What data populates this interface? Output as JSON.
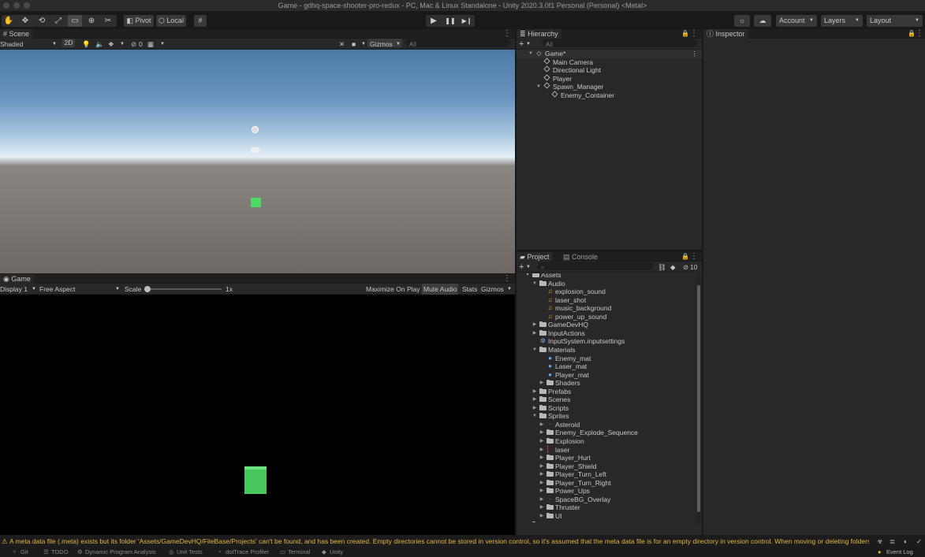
{
  "window": {
    "title": "Game - gdhq-space-shooter-pro-redux - PC, Mac & Linux Standalone - Unity 2020.3.0f1 Personal (Personal) <Metal>"
  },
  "toolbar": {
    "pivot_label": "Pivot",
    "local_label": "Local",
    "account_label": "Account",
    "layers_label": "Layers",
    "layout_label": "Layout"
  },
  "scene": {
    "tab_label": "Scene",
    "shading_mode": "Shaded",
    "mode_2d": "2D",
    "hidden_count": "0",
    "gizmos_label": "Gizmos",
    "search_placeholder": "All"
  },
  "game": {
    "tab_label": "Game",
    "display": "Display 1",
    "aspect": "Free Aspect",
    "scale_label": "Scale",
    "scale_value": "1x",
    "scale_level": 0,
    "maximize_label": "Maximize On Play",
    "mute_label": "Mute Audio",
    "stats_label": "Stats",
    "gizmos_label": "Gizmos"
  },
  "hierarchy": {
    "tab_label": "Hierarchy",
    "search_placeholder": "All",
    "items": [
      {
        "label": "Game*",
        "depth": 0,
        "expanded": true,
        "kind": "scene"
      },
      {
        "label": "Main Camera",
        "depth": 1,
        "kind": "object"
      },
      {
        "label": "Directional Light",
        "depth": 1,
        "kind": "object"
      },
      {
        "label": "Player",
        "depth": 1,
        "kind": "object"
      },
      {
        "label": "Spawn_Manager",
        "depth": 1,
        "expanded": true,
        "kind": "object"
      },
      {
        "label": "Enemy_Container",
        "depth": 2,
        "kind": "object"
      }
    ]
  },
  "inspector": {
    "tab_label": "Inspector"
  },
  "project": {
    "tab_label": "Project",
    "console_label": "Console",
    "hidden_count": "10",
    "items": [
      {
        "label": "Assets",
        "depth": 0,
        "kind": "folder",
        "expanded": true
      },
      {
        "label": "Audio",
        "depth": 1,
        "kind": "folder",
        "expanded": true
      },
      {
        "label": "explosion_sound",
        "depth": 2,
        "kind": "audio"
      },
      {
        "label": "laser_shot",
        "depth": 2,
        "kind": "audio"
      },
      {
        "label": "music_background",
        "depth": 2,
        "kind": "audio"
      },
      {
        "label": "power_up_sound",
        "depth": 2,
        "kind": "audio"
      },
      {
        "label": "GameDevHQ",
        "depth": 1,
        "kind": "folder",
        "collapsed": true
      },
      {
        "label": "InputActions",
        "depth": 1,
        "kind": "folder",
        "collapsed": true
      },
      {
        "label": "InputSystem.inputsettings",
        "depth": 1,
        "kind": "settings"
      },
      {
        "label": "Materials",
        "depth": 1,
        "kind": "folder",
        "expanded": true
      },
      {
        "label": "Enemy_mat",
        "depth": 2,
        "kind": "material"
      },
      {
        "label": "Laser_mat",
        "depth": 2,
        "kind": "material"
      },
      {
        "label": "Player_mat",
        "depth": 2,
        "kind": "material"
      },
      {
        "label": "Shaders",
        "depth": 2,
        "kind": "folder",
        "collapsed": true
      },
      {
        "label": "Prefabs",
        "depth": 1,
        "kind": "folder",
        "collapsed": true
      },
      {
        "label": "Scenes",
        "depth": 1,
        "kind": "folder",
        "collapsed": true
      },
      {
        "label": "Scripts",
        "depth": 1,
        "kind": "folder",
        "collapsed": true
      },
      {
        "label": "Sprites",
        "depth": 1,
        "kind": "folder",
        "expanded": true
      },
      {
        "label": "Asteroid",
        "depth": 2,
        "kind": "sprite",
        "collapsed": true
      },
      {
        "label": "Enemy_Explode_Sequence",
        "depth": 2,
        "kind": "folder",
        "collapsed": true
      },
      {
        "label": "Explosion",
        "depth": 2,
        "kind": "folder",
        "collapsed": true
      },
      {
        "label": "laser",
        "depth": 2,
        "kind": "sprite-red",
        "collapsed": true
      },
      {
        "label": "Player_Hurt",
        "depth": 2,
        "kind": "folder",
        "collapsed": true
      },
      {
        "label": "Player_Shield",
        "depth": 2,
        "kind": "folder",
        "collapsed": true
      },
      {
        "label": "Player_Turn_Left",
        "depth": 2,
        "kind": "folder",
        "collapsed": true
      },
      {
        "label": "Player_Turn_Right",
        "depth": 2,
        "kind": "folder",
        "collapsed": true
      },
      {
        "label": "Power_Ups",
        "depth": 2,
        "kind": "folder",
        "collapsed": true
      },
      {
        "label": "SpaceBG_Overlay",
        "depth": 2,
        "kind": "sprite",
        "collapsed": true
      },
      {
        "label": "Thruster",
        "depth": 2,
        "kind": "folder",
        "collapsed": true
      },
      {
        "label": "UI",
        "depth": 2,
        "kind": "folder",
        "collapsed": true
      },
      {
        "label": "Packages",
        "depth": 0,
        "kind": "folder",
        "collapsed": true
      }
    ]
  },
  "status": {
    "message": "A meta data file (.meta) exists but its folder 'Assets/GameDevHQ/FileBase/Projects' can't be found, and has been created. Empty directories cannot be stored in version control, so it's assumed that the meta data file is for an empty directory in version control. When moving or deleting folders out",
    "event_log": "Event Log"
  },
  "bottom_tabs": [
    "Git",
    "TODO",
    "Dynamic Program Analysis",
    "Unit Tests",
    "dotTrace Profiler",
    "Terminal",
    "Unity"
  ],
  "colors": {
    "accent_green": "#4cd964",
    "warning": "#e3b341",
    "panel": "#282828"
  }
}
